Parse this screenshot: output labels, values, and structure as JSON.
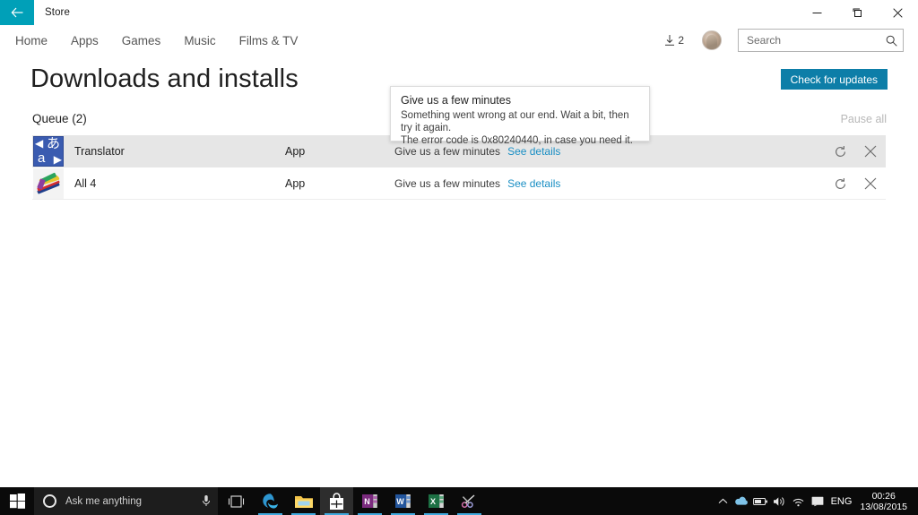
{
  "window": {
    "title": "Store",
    "back_icon": "back-arrow-icon",
    "minimize_icon": "minimize-icon",
    "maximize_icon": "maximize-icon",
    "close_icon": "close-icon",
    "accent_color": "#00a0b8"
  },
  "nav": {
    "items": [
      {
        "label": "Home"
      },
      {
        "label": "Apps"
      },
      {
        "label": "Games"
      },
      {
        "label": "Music"
      },
      {
        "label": "Films & TV"
      }
    ],
    "downloads_count": "2",
    "downloads_icon": "download-arrow-icon",
    "avatar": "user-avatar",
    "search": {
      "placeholder": "Search",
      "value": "",
      "icon": "search-icon"
    }
  },
  "page": {
    "title": "Downloads and installs",
    "check_updates_label": "Check for updates",
    "check_updates_color": "#0d7ea8",
    "queue_header": "Queue (2)",
    "pause_all_label": "Pause all",
    "pause_all_disabled": true
  },
  "queue": {
    "rows": [
      {
        "name": "Translator",
        "type": "App",
        "status": "Give us a few minutes",
        "link": "See details",
        "icon": "translator-app-icon",
        "highlighted": true,
        "retry_icon": "retry-icon",
        "cancel_icon": "cancel-icon"
      },
      {
        "name": "All 4",
        "type": "App",
        "status": "Give us a few minutes",
        "link": "See details",
        "icon": "all4-app-icon",
        "highlighted": false,
        "retry_icon": "retry-icon",
        "cancel_icon": "cancel-icon"
      }
    ]
  },
  "tooltip": {
    "title": "Give us a few minutes",
    "line1": "Something went wrong at our end. Wait a bit, then try it again.",
    "line2": "The error code is 0x80240440, in case you need it.",
    "error_code": "0x80240440"
  },
  "taskbar": {
    "start_icon": "windows-start-icon",
    "cortana_placeholder": "Ask me anything",
    "cortana_circle_icon": "cortana-circle-icon",
    "mic_icon": "microphone-icon",
    "taskview_icon": "task-view-icon",
    "apps": [
      {
        "name": "edge",
        "label": "Microsoft Edge",
        "active": false,
        "open": true
      },
      {
        "name": "explorer",
        "label": "File Explorer",
        "active": false,
        "open": true
      },
      {
        "name": "store",
        "label": "Store",
        "active": true,
        "open": true
      },
      {
        "name": "onenote",
        "label": "OneNote",
        "active": false,
        "open": true
      },
      {
        "name": "word",
        "label": "Word",
        "active": false,
        "open": true
      },
      {
        "name": "excel",
        "label": "Excel",
        "active": false,
        "open": true
      },
      {
        "name": "snip",
        "label": "Snipping Tool",
        "active": false,
        "open": true
      }
    ],
    "tray": {
      "chevron_icon": "show-hidden-icons-icon",
      "onedrive_icon": "onedrive-icon",
      "battery_icon": "battery-icon",
      "volume_icon": "volume-icon",
      "wifi_icon": "wifi-icon",
      "action_center_icon": "action-center-icon",
      "language": "ENG",
      "time": "00:26",
      "date": "13/08/2015"
    }
  }
}
